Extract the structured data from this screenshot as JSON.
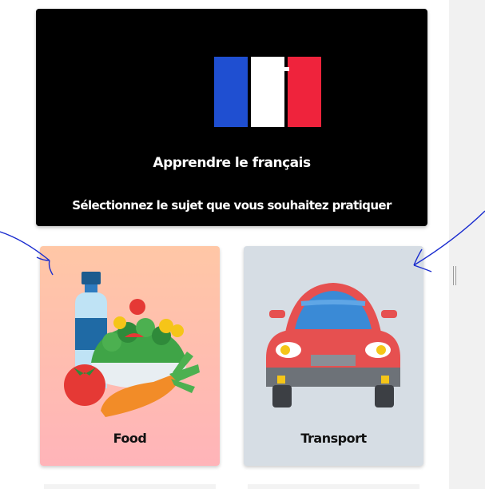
{
  "hero": {
    "title": "Apprendre le français",
    "subtitle": "Sélectionnez le sujet que vous souhaitez pratiquer",
    "background": "#000000",
    "flag_colors": [
      "#1f4fd1",
      "#ffffff",
      "#ef233c"
    ]
  },
  "topics": [
    {
      "label": "Food",
      "icon": "food-illustration-icon",
      "background": "#ffc7a6"
    },
    {
      "label": "Transport",
      "icon": "car-illustration-icon",
      "background": "#d6dde4"
    }
  ],
  "annotations": {
    "arrow_color": "#1a2ccf"
  }
}
